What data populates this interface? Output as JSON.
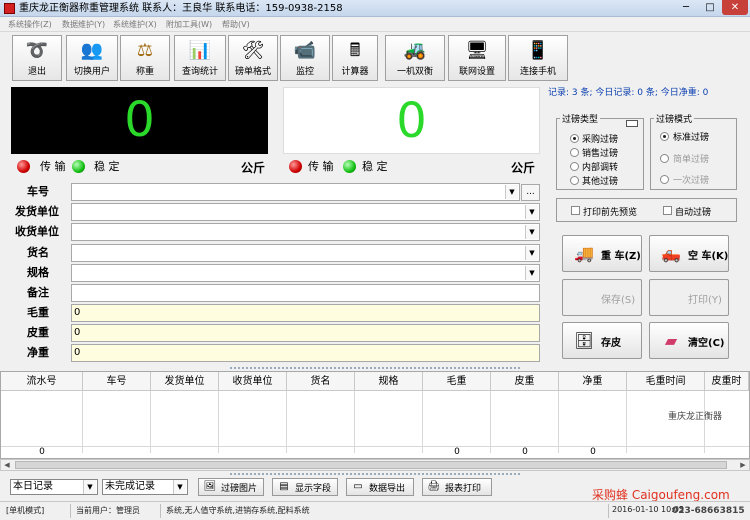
{
  "window": {
    "title": "重庆龙正衡器称重管理系统  联系人：王良华  联系电话：159-0938-2158",
    "min_glyph": "─",
    "max_glyph": "□",
    "close_glyph": "✕"
  },
  "menu": [
    "系统操作(Z)",
    "数据维护(Y)",
    "系统维护(X)",
    "附加工具(W)",
    "帮助(V)"
  ],
  "toolbar": [
    {
      "label": "退出",
      "icon": "exit-icon",
      "glyph": "➰"
    },
    {
      "label": "切换用户",
      "icon": "users-icon",
      "glyph": "👥"
    },
    {
      "label": "称重",
      "icon": "scale-icon",
      "glyph": "⚖"
    },
    {
      "label": "查询统计",
      "icon": "statistics-icon",
      "glyph": "📊"
    },
    {
      "label": "磅单格式",
      "icon": "tools-icon",
      "glyph": "🛠"
    },
    {
      "label": "监控",
      "icon": "camera-icon",
      "glyph": "📹"
    },
    {
      "label": "计算器",
      "icon": "calculator-icon",
      "glyph": "🖩"
    },
    {
      "label": "一机双衡",
      "icon": "forklift-icon",
      "glyph": "🚜"
    },
    {
      "label": "联网设置",
      "icon": "network-icon",
      "glyph": "🖥"
    },
    {
      "label": "连接手机",
      "icon": "phone-icon",
      "glyph": "📱"
    }
  ],
  "display1": {
    "value": "0",
    "status1": "传 输",
    "status2": "稳 定",
    "unit": "公斤"
  },
  "display2": {
    "value": "0",
    "status1": "传 输",
    "status2": "稳 定",
    "unit": "公斤"
  },
  "form": {
    "plate": {
      "label": "车号",
      "value": ""
    },
    "sender": {
      "label": "发货单位",
      "value": ""
    },
    "receiver": {
      "label": "收货单位",
      "value": ""
    },
    "goods": {
      "label": "货名",
      "value": ""
    },
    "spec": {
      "label": "规格",
      "value": ""
    },
    "remark": {
      "label": "备注",
      "value": ""
    },
    "gross": {
      "label": "毛重",
      "value": "0"
    },
    "tare": {
      "label": "皮重",
      "value": "0"
    },
    "net": {
      "label": "净重",
      "value": "0"
    },
    "ellipsis": "..."
  },
  "stats": "记录: 3 条; 今日记录: 0 条; 今日净重: 0",
  "weigh_type": {
    "title": "过磅类型",
    "options": [
      "采购过磅",
      "销售过磅",
      "内部调转",
      "其他过磅"
    ],
    "selected": 0
  },
  "weigh_mode": {
    "title": "过磅模式",
    "options": [
      "标准过磅",
      "简单过磅",
      "一次过磅"
    ],
    "selected": 0
  },
  "checks": {
    "preview": "打印前先预览",
    "auto": "自动过磅"
  },
  "actions": {
    "heavy": "重 车(Z)",
    "empty": "空 车(K)",
    "save": "保存(S)",
    "print": "打印(Y)",
    "store_tare": "存皮",
    "clear": "清空(C)"
  },
  "table": {
    "columns": [
      "流水号",
      "车号",
      "发货单位",
      "收货单位",
      "货名",
      "规格",
      "毛重",
      "皮重",
      "净重",
      "毛重时间",
      "皮重时"
    ],
    "summary": [
      "0",
      "",
      "",
      "",
      "",
      "",
      "0",
      "0",
      "0",
      "",
      ""
    ]
  },
  "scroll": {
    "left": "◀",
    "right": "▶"
  },
  "bottom": {
    "range": "本日记录",
    "status": "未完成记录",
    "buttons": [
      "过磅图片",
      "显示字段",
      "数据导出",
      "报表打印"
    ]
  },
  "statusbar": {
    "mode": "[单机模式]",
    "user": "当前用户：管理员",
    "info": "系统,无人值守系统,进销存系统,配料系统",
    "datetime": "2016-01-10 10:05"
  },
  "watermark": "采购蜂 Caigoufeng.com",
  "corner_logo": "重庆龙正衡器",
  "corner_phone": "023-68663815",
  "colors": {
    "display_digits": "#2bd92b",
    "stats_text": "#0b3fb0",
    "close_button": "#c7403a"
  }
}
